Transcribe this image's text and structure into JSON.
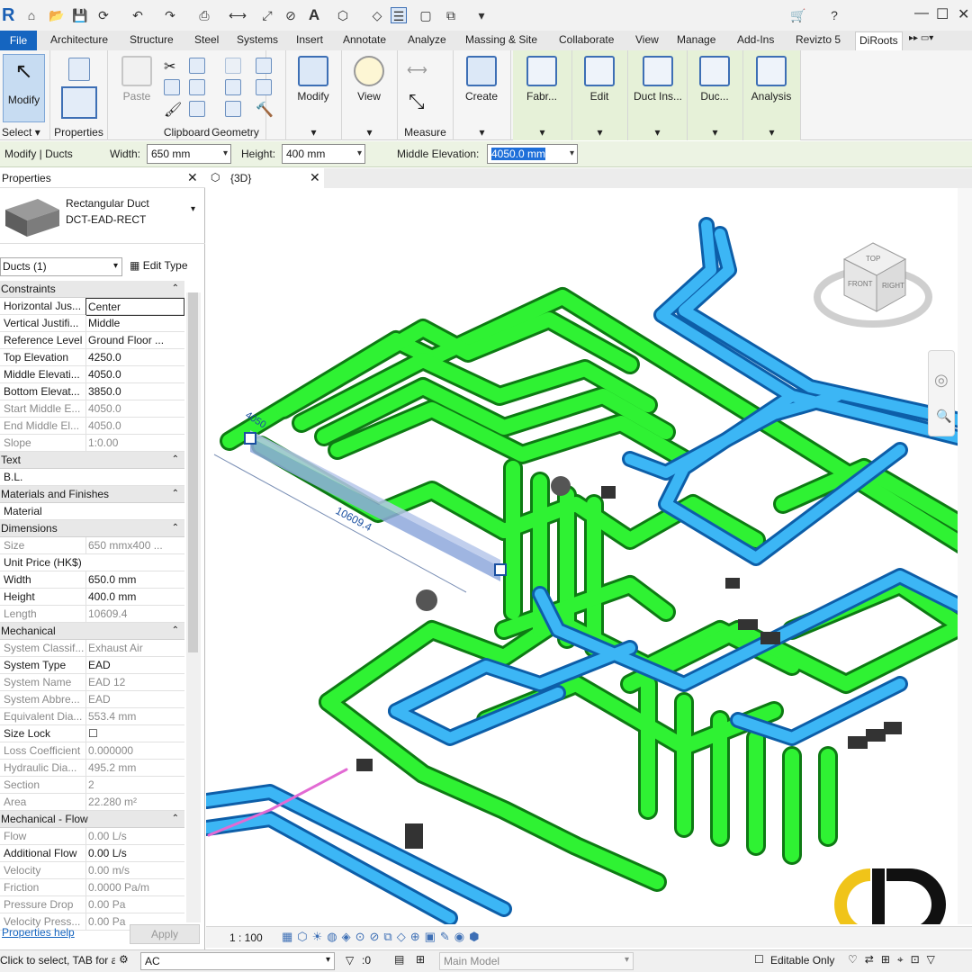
{
  "app_logo": "R",
  "tabs": [
    "File",
    "Architecture",
    "Structure",
    "Steel",
    "Systems",
    "Insert",
    "Annotate",
    "Analyze",
    "Massing & Site",
    "Collaborate",
    "View",
    "Manage",
    "Add-Ins",
    "Revizto 5",
    "DiRoots"
  ],
  "ribbon": {
    "modify_label": "Modify",
    "paste_label": "Paste",
    "properties_label": "Properties",
    "modify2_label": "Modify",
    "view_label": "View",
    "create_label": "Create",
    "fabr_label": "Fabr...",
    "edit_label": "Edit",
    "duct_ins_label": "Duct Ins...",
    "duc_label": "Duc...",
    "analysis_label": "Analysis",
    "panels": {
      "select": "Select",
      "clipboard": "Clipboard",
      "geometry": "Geometry",
      "measure": "Measure"
    }
  },
  "options_bar": {
    "context": "Modify | Ducts",
    "width_label": "Width:",
    "width_value": "650 mm",
    "height_label": "Height:",
    "height_value": "400 mm",
    "mid_elev_label": "Middle Elevation:",
    "mid_elev_value": "4050.0 mm"
  },
  "properties": {
    "title": "Properties",
    "type_line1": "Rectangular Duct",
    "type_line2": "DCT-EAD-RECT",
    "filter": "Ducts (1)",
    "edit_type": "Edit Type",
    "rows": [
      {
        "head": "Constraints"
      },
      {
        "k": "Horizontal Jus...",
        "v": "Center"
      },
      {
        "k": "Vertical Justifi...",
        "v": "Middle"
      },
      {
        "k": "Reference Level",
        "v": "Ground Floor ..."
      },
      {
        "k": "Top Elevation",
        "v": "4250.0"
      },
      {
        "k": "Middle Elevati...",
        "v": "4050.0"
      },
      {
        "k": "Bottom Elevat...",
        "v": "3850.0"
      },
      {
        "k": "Start Middle E...",
        "v": "4050.0",
        "grey": true
      },
      {
        "k": "End Middle El...",
        "v": "4050.0",
        "grey": true
      },
      {
        "k": "Slope",
        "v": "1:0.00",
        "grey": true
      },
      {
        "head": "Text"
      },
      {
        "k": "B.L.",
        "v": ""
      },
      {
        "head": "Materials and Finishes"
      },
      {
        "k": "Material",
        "v": ""
      },
      {
        "head": "Dimensions"
      },
      {
        "k": "Size",
        "v": "650 mmx400 ...",
        "grey": true
      },
      {
        "k": "Unit Price (HK$)",
        "v": ""
      },
      {
        "k": "Width",
        "v": "650.0 mm"
      },
      {
        "k": "Height",
        "v": "400.0 mm"
      },
      {
        "k": "Length",
        "v": "10609.4",
        "grey": true
      },
      {
        "head": "Mechanical"
      },
      {
        "k": "System Classif...",
        "v": "Exhaust Air",
        "grey": true
      },
      {
        "k": "System Type",
        "v": "EAD"
      },
      {
        "k": "System Name",
        "v": "EAD 12",
        "grey": true
      },
      {
        "k": "System Abbre...",
        "v": "EAD",
        "grey": true
      },
      {
        "k": "Equivalent Dia...",
        "v": "553.4 mm",
        "grey": true
      },
      {
        "k": "Size Lock",
        "v": "☐"
      },
      {
        "k": "Loss Coefficient",
        "v": "0.000000",
        "grey": true
      },
      {
        "k": "Hydraulic Dia...",
        "v": "495.2 mm",
        "grey": true
      },
      {
        "k": "Section",
        "v": "2",
        "grey": true
      },
      {
        "k": "Area",
        "v": "22.280 m²",
        "grey": true
      },
      {
        "head": "Mechanical - Flow"
      },
      {
        "k": "Flow",
        "v": "0.00 L/s",
        "grey": true
      },
      {
        "k": "Additional Flow",
        "v": "0.00 L/s"
      },
      {
        "k": "Velocity",
        "v": "0.00 m/s",
        "grey": true
      },
      {
        "k": "Friction",
        "v": "0.0000 Pa/m",
        "grey": true
      },
      {
        "k": "Pressure Drop",
        "v": "0.00 Pa",
        "grey": true
      },
      {
        "k": "Velocity Press...",
        "v": "0.00 Pa",
        "grey": true
      }
    ],
    "help": "Properties help",
    "apply": "Apply"
  },
  "view": {
    "tab_label": "{3D}",
    "dim_length": "10609.4",
    "dim_elev": "4050",
    "cube_top": "TOP",
    "cube_front": "FRONT",
    "cube_right": "RIGHT",
    "scale": "1 : 100"
  },
  "status": {
    "hint": "Click to select, TAB for a",
    "workset": "AC",
    "count": ":0",
    "model": "Main Model",
    "editable": "Editable Only"
  },
  "colors": {
    "exhaust": "#22e52a",
    "supply": "#2aa8f0",
    "ribbon_accent": "#1565c0"
  }
}
